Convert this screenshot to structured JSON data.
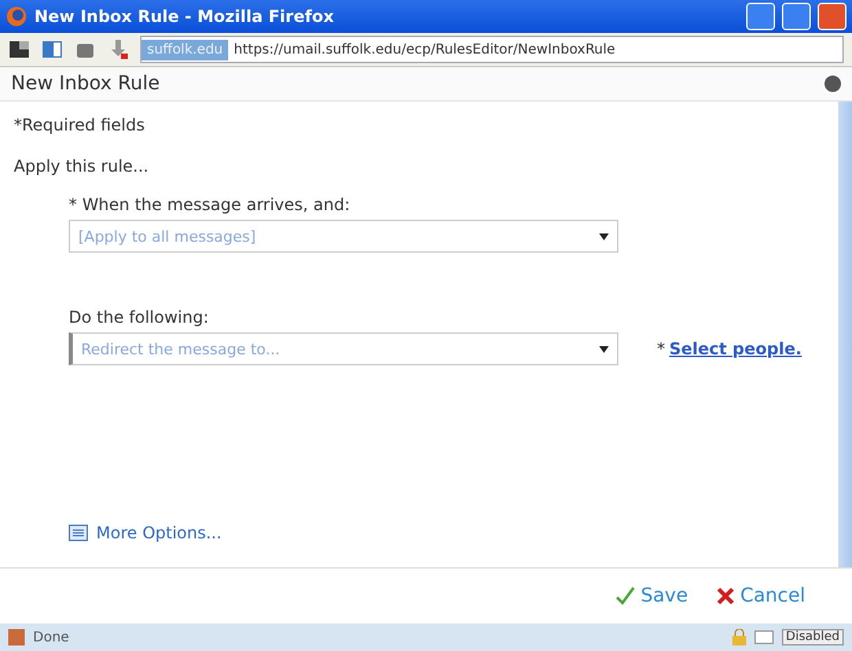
{
  "window": {
    "title": "New Inbox Rule - Mozilla Firefox"
  },
  "toolbar": {
    "site_badge": "suffolk.edu",
    "url": "https://umail.suffolk.edu/ecp/RulesEditor/NewInboxRule"
  },
  "page": {
    "heading": "New Inbox Rule",
    "required_note": "*Required fields",
    "section_label": "Apply this rule...",
    "conditions": [
      {
        "label": "* When the message arrives, and:",
        "placeholder": "[Apply to all messages]",
        "marked": false
      },
      {
        "label": "Do the following:",
        "placeholder": "Redirect the message to...",
        "marked": true,
        "link_star": "*",
        "link": "Select people."
      }
    ],
    "more_options": "More Options...",
    "buttons": [
      {
        "kind": "save",
        "label": "Save"
      },
      {
        "kind": "cancel",
        "label": "Cancel"
      }
    ]
  },
  "status_bar": {
    "text": "Done",
    "badge": "Disabled"
  }
}
